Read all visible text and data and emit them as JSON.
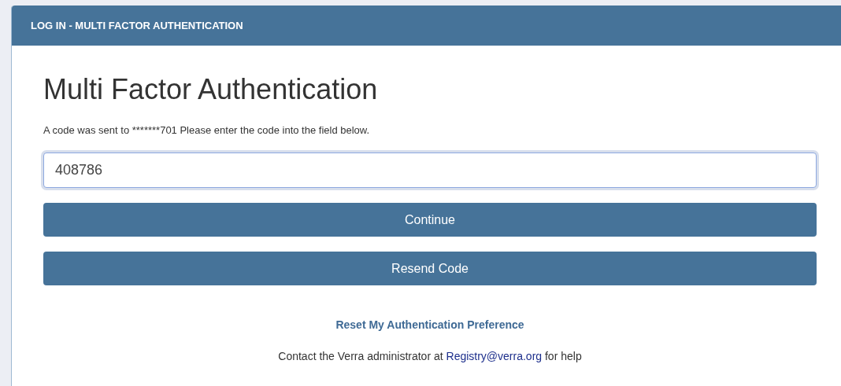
{
  "panel": {
    "title": "LOG IN - MULTI FACTOR AUTHENTICATION"
  },
  "heading": "Multi Factor Authentication",
  "message": "A code was sent to *******701 Please enter the code into the field below.",
  "code_field": {
    "value": "408786",
    "focused": true
  },
  "buttons": [
    {
      "label": "Continue"
    },
    {
      "label": "Resend Code"
    }
  ],
  "reset_link": "Reset My Authentication Preference",
  "contact": {
    "before": "Contact the Verra administrator at",
    "link": "Registry@verra.org",
    "after": "for help"
  }
}
